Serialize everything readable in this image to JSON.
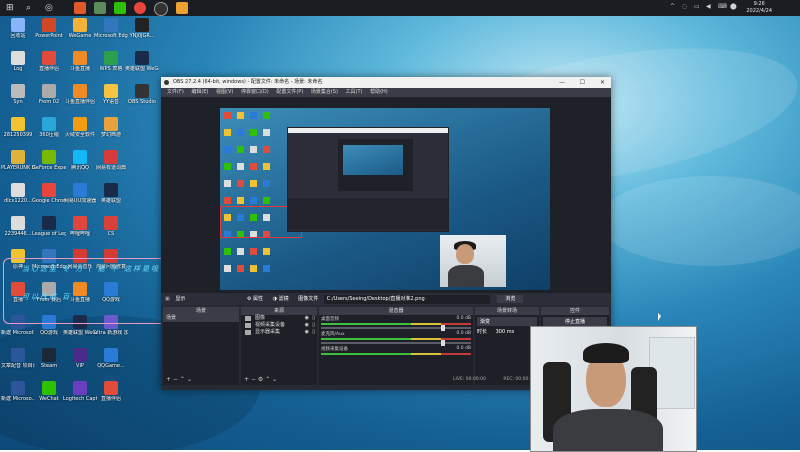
{
  "taskbar": {
    "tray_icons": [
      "^",
      "◌",
      "▭",
      "◀",
      "⌨",
      "⬤"
    ],
    "clock_time": "9:26",
    "clock_date": "2022/4/24"
  },
  "desktop_icons": [
    {
      "label": "回收站",
      "color": "#8ab4f8",
      "col": 0,
      "row": 0
    },
    {
      "label": "PowerPoint",
      "color": "#d24726",
      "col": 1,
      "row": 0
    },
    {
      "label": "WeGame",
      "color": "#f2b138",
      "col": 2,
      "row": 0
    },
    {
      "label": "Microsoft Edge",
      "color": "#3277bc",
      "col": 3,
      "row": 0
    },
    {
      "label": "YNJ0JGR...",
      "color": "#222",
      "col": 4,
      "row": 0
    },
    {
      "label": "Log",
      "color": "#ddd",
      "col": 0,
      "row": 1
    },
    {
      "label": "直播伴侣",
      "color": "#e04b3a",
      "col": 1,
      "row": 1
    },
    {
      "label": "斗鱼直播",
      "color": "#f08a24",
      "col": 2,
      "row": 1
    },
    {
      "label": "WPS 表格",
      "color": "#2c9f4d",
      "col": 3,
      "row": 1
    },
    {
      "label": "英雄联盟 WeGame版",
      "color": "#1a2a4a",
      "col": 4,
      "row": 1
    },
    {
      "label": "Syn",
      "color": "#bbb",
      "col": 0,
      "row": 2
    },
    {
      "label": "From 02",
      "color": "#aaa",
      "col": 1,
      "row": 2
    },
    {
      "label": "斗鱼直播伴侣",
      "color": "#f08a24",
      "col": 2,
      "row": 2
    },
    {
      "label": "YY语音",
      "color": "#f6c343",
      "col": 3,
      "row": 2
    },
    {
      "label": "OBS Studio",
      "color": "#333",
      "col": 4,
      "row": 2
    },
    {
      "label": "281250399",
      "color": "#f1c232",
      "col": 0,
      "row": 3
    },
    {
      "label": "360压缩",
      "color": "#2aa7d8",
      "col": 1,
      "row": 3
    },
    {
      "label": "火绒安全软件",
      "color": "#f39c12",
      "col": 2,
      "row": 3
    },
    {
      "label": "梦幻西游",
      "color": "#e6a23c",
      "col": 3,
      "row": 3
    },
    {
      "label": "PLAYERUNK BATTLEGR...",
      "color": "#e0b23a",
      "col": 0,
      "row": 4
    },
    {
      "label": "GeForce Experience",
      "color": "#76b900",
      "col": 1,
      "row": 4
    },
    {
      "label": "腾讯QQ",
      "color": "#12b7f5",
      "col": 2,
      "row": 4
    },
    {
      "label": "网易有道词典",
      "color": "#d83b3b",
      "col": 3,
      "row": 4
    },
    {
      "label": "dlcx1220...",
      "color": "#ddd",
      "col": 0,
      "row": 5
    },
    {
      "label": "Google Chrome",
      "color": "#e8453c",
      "col": 1,
      "row": 5
    },
    {
      "label": "网易UU加速器",
      "color": "#2a7bd5",
      "col": 2,
      "row": 5
    },
    {
      "label": "英雄联盟",
      "color": "#1a2a4a",
      "col": 3,
      "row": 5
    },
    {
      "label": "2239446...",
      "color": "#ddd",
      "col": 0,
      "row": 6
    },
    {
      "label": "League of Legends",
      "color": "#1a2a4a",
      "col": 1,
      "row": 6
    },
    {
      "label": "哔哩哔哩",
      "color": "#e0463c",
      "col": 2,
      "row": 6
    },
    {
      "label": "CS",
      "color": "#d9403a",
      "col": 3,
      "row": 6
    },
    {
      "label": "原神",
      "color": "#f1c232",
      "col": 0,
      "row": 7
    },
    {
      "label": "Microsoft Edge",
      "color": "#3277bc",
      "col": 1,
      "row": 7
    },
    {
      "label": "网易云音乐",
      "color": "#d43c33",
      "col": 2,
      "row": 7
    },
    {
      "label": "鸿蒙问题修复",
      "color": "#d43c33",
      "col": 3,
      "row": 7
    },
    {
      "label": "直播",
      "color": "#e04b3a",
      "col": 0,
      "row": 8
    },
    {
      "label": "From 赛后",
      "color": "#aaa",
      "col": 1,
      "row": 8
    },
    {
      "label": "斗鱼直播",
      "color": "#f08a24",
      "col": 2,
      "row": 8
    },
    {
      "label": "QQ游戏",
      "color": "#2a7bd5",
      "col": 3,
      "row": 8
    },
    {
      "label": "新建 Microsof...",
      "color": "#2b579a",
      "col": 0,
      "row": 9
    },
    {
      "label": "QQ游戏",
      "color": "#2a7bd5",
      "col": 1,
      "row": 9
    },
    {
      "label": "英雄联盟 WeGame版",
      "color": "#1a2a4a",
      "col": 2,
      "row": 9
    },
    {
      "label": "ultra 新游戏 加速器",
      "color": "#6a5acd",
      "col": 3,
      "row": 9
    },
    {
      "label": "Steam",
      "color": "#1b2838",
      "col": 1,
      "row": 10
    },
    {
      "label": "VIP",
      "color": "#4a2a8a",
      "col": 2,
      "row": 10
    },
    {
      "label": "QQGame...",
      "color": "#2a7bd5",
      "col": 3,
      "row": 10
    },
    {
      "label": "文章配音 项目计划",
      "color": "#2b579a",
      "col": 0,
      "row": 10
    },
    {
      "label": "新建 Microso...",
      "color": "#2b579a",
      "col": 0,
      "row": 11
    },
    {
      "label": "WeChat",
      "color": "#2dc100",
      "col": 1,
      "row": 11
    },
    {
      "label": "Logitech Capture",
      "color": "#6a3fbf",
      "col": 2,
      "row": 11
    },
    {
      "label": "直播伴侣",
      "color": "#e04b3a",
      "col": 3,
      "row": 11
    }
  ],
  "obs": {
    "title": "OBS 27.2.4 (64-bit, windows) - 配置文件: 未命名 - 场景: 未命名",
    "menu": [
      "文件(F)",
      "编辑(E)",
      "视图(V)",
      "停靠窗口(D)",
      "配置文件(P)",
      "场景集合(S)",
      "工具(T)",
      "帮助(H)"
    ],
    "toolbar": {
      "scene_label": "显示",
      "properties": "属性",
      "filters": "滤镜",
      "image_file": "图像文件",
      "path": "C:/Users/Seeing/Desktop/直播对准2.png",
      "browse": "浏览"
    },
    "docks": {
      "scenes": {
        "title": "场景",
        "items": [
          "场景"
        ]
      },
      "sources": {
        "title": "来源",
        "items": [
          "图像",
          "视频采集设备",
          "显示器采集"
        ]
      },
      "mixer": {
        "title": "混音器",
        "channels": [
          {
            "name": "桌面音频",
            "db": "0.0 dB"
          },
          {
            "name": "麦克风/Aux",
            "db": "0.0 dB"
          },
          {
            "name": "视频采集设备",
            "db": "0.0 dB"
          }
        ]
      },
      "transitions": {
        "title": "场景转场",
        "mode": "渐变",
        "duration_label": "时长",
        "duration": "300 ms"
      },
      "controls": {
        "title": "控件",
        "item": "停止直播"
      }
    },
    "status": {
      "live": "LIVE: 00:00:00",
      "rec": "REC: 00:00:00"
    }
  },
  "annotation": {
    "line1": "当心这里  冬  方  (  能  不  这样是哦",
    "line2": "可以改成 百"
  }
}
